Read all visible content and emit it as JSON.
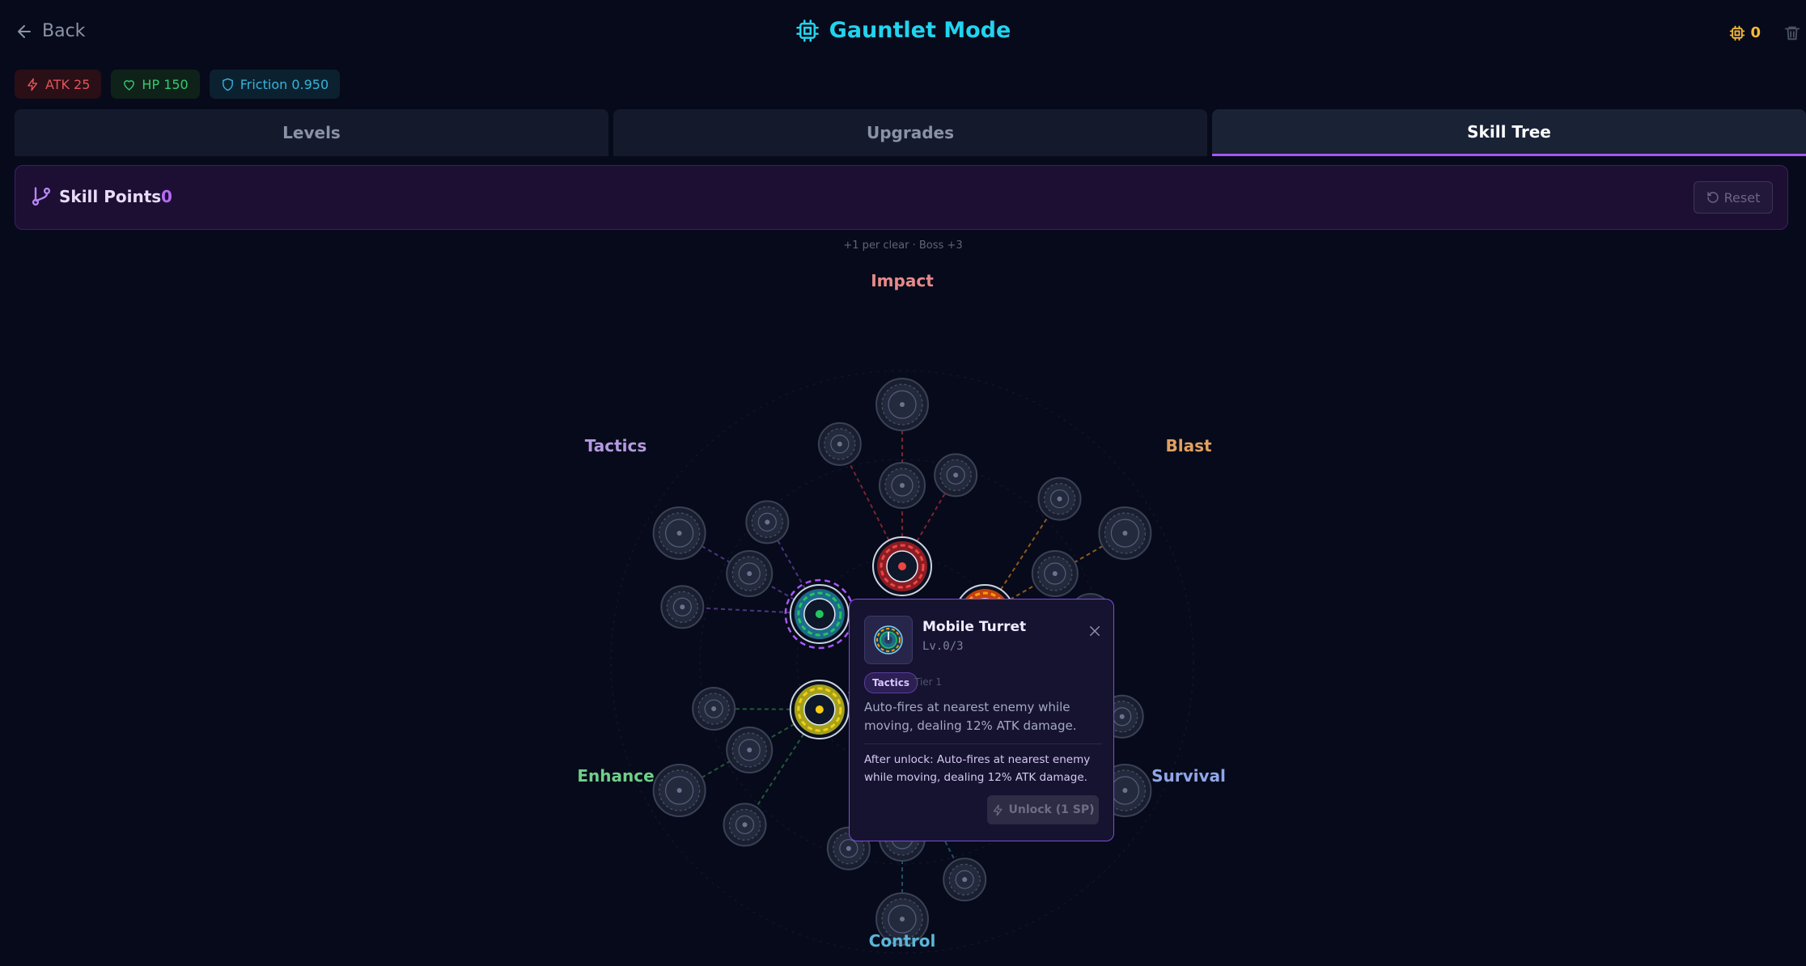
{
  "header": {
    "back_label": "Back",
    "title": "Gauntlet Mode",
    "coins": "0"
  },
  "stats": {
    "atk": "ATK 25",
    "hp": "HP 150",
    "friction": "Friction 0.950"
  },
  "tabs": [
    {
      "label": "Levels",
      "active": false
    },
    {
      "label": "Upgrades",
      "active": false
    },
    {
      "label": "Skill Tree",
      "active": true
    }
  ],
  "skill_points": {
    "label": "Skill Points",
    "value": "0",
    "reset_label": "Reset",
    "hint": "+1 per clear · Boss +3"
  },
  "tree": {
    "branches": [
      {
        "id": "impact",
        "label": "Impact",
        "color": "#e58a8a"
      },
      {
        "id": "blast",
        "label": "Blast",
        "color": "#e0a060"
      },
      {
        "id": "survival",
        "label": "Survival",
        "color": "#8fa6e8"
      },
      {
        "id": "control",
        "label": "Control",
        "color": "#5ab6d8"
      },
      {
        "id": "enhance",
        "label": "Enhance",
        "color": "#6fcf8a"
      },
      {
        "id": "tactics",
        "label": "Tactics",
        "color": "#b39ae0"
      }
    ],
    "line_colors": {
      "impact": "#7a2430",
      "blast": "#8a5a1e",
      "survival": "#2b3f6f",
      "control": "#1f4f66",
      "enhance": "#1f5a3c",
      "tactics": "#4a3580"
    },
    "active_nodes": [
      "impact-t1",
      "blast-t1",
      "tactics-t1",
      "enhance-t1"
    ],
    "selected_node": "tactics-t1"
  },
  "tooltip": {
    "name": "Mobile Turret",
    "level": "Lv.0/3",
    "tag": "Tactics",
    "tier": "Tier 1",
    "description": "Auto-fires at nearest enemy while moving, dealing 12% ATK damage.",
    "after_unlock": "After unlock: Auto-fires at nearest enemy while moving, dealing 12% ATK damage.",
    "unlock_label": "Unlock (1 SP)",
    "close_icon": "close-icon"
  }
}
